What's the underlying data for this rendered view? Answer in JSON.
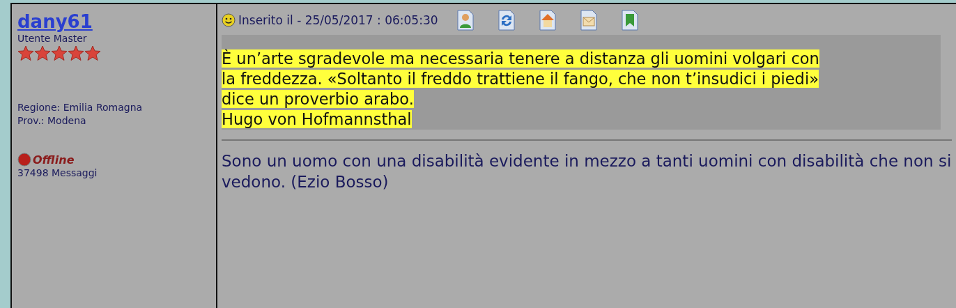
{
  "author": {
    "username": "dany61",
    "rank": "Utente Master",
    "stars": 5,
    "region": "Regione: Emilia Romagna",
    "province": "Prov.: Modena",
    "status": {
      "label": "Offline",
      "online": false
    },
    "posts": "37498 Messaggi"
  },
  "post": {
    "posted": "Inserito il - 25/05/2017 : 06:05:30",
    "actions": [
      {
        "kind": "profile"
      },
      {
        "kind": "refresh"
      },
      {
        "kind": "home"
      },
      {
        "kind": "mail"
      },
      {
        "kind": "bookmark"
      }
    ],
    "quote": {
      "lines": [
        "È un’arte sgradevole ma necessaria tenere a distanza gli uomini volgari con",
        "la freddezza. «Soltanto il freddo trattiene il fango, che non t’insudici i piedi»",
        "dice un proverbio arabo."
      ],
      "author": "Hugo von Hofmannsthal"
    },
    "signature": "Sono un uomo con una disabilità evidente in mezzo a tanti uomini con disabilità che non si vedono. (Ezio Bosso)"
  }
}
